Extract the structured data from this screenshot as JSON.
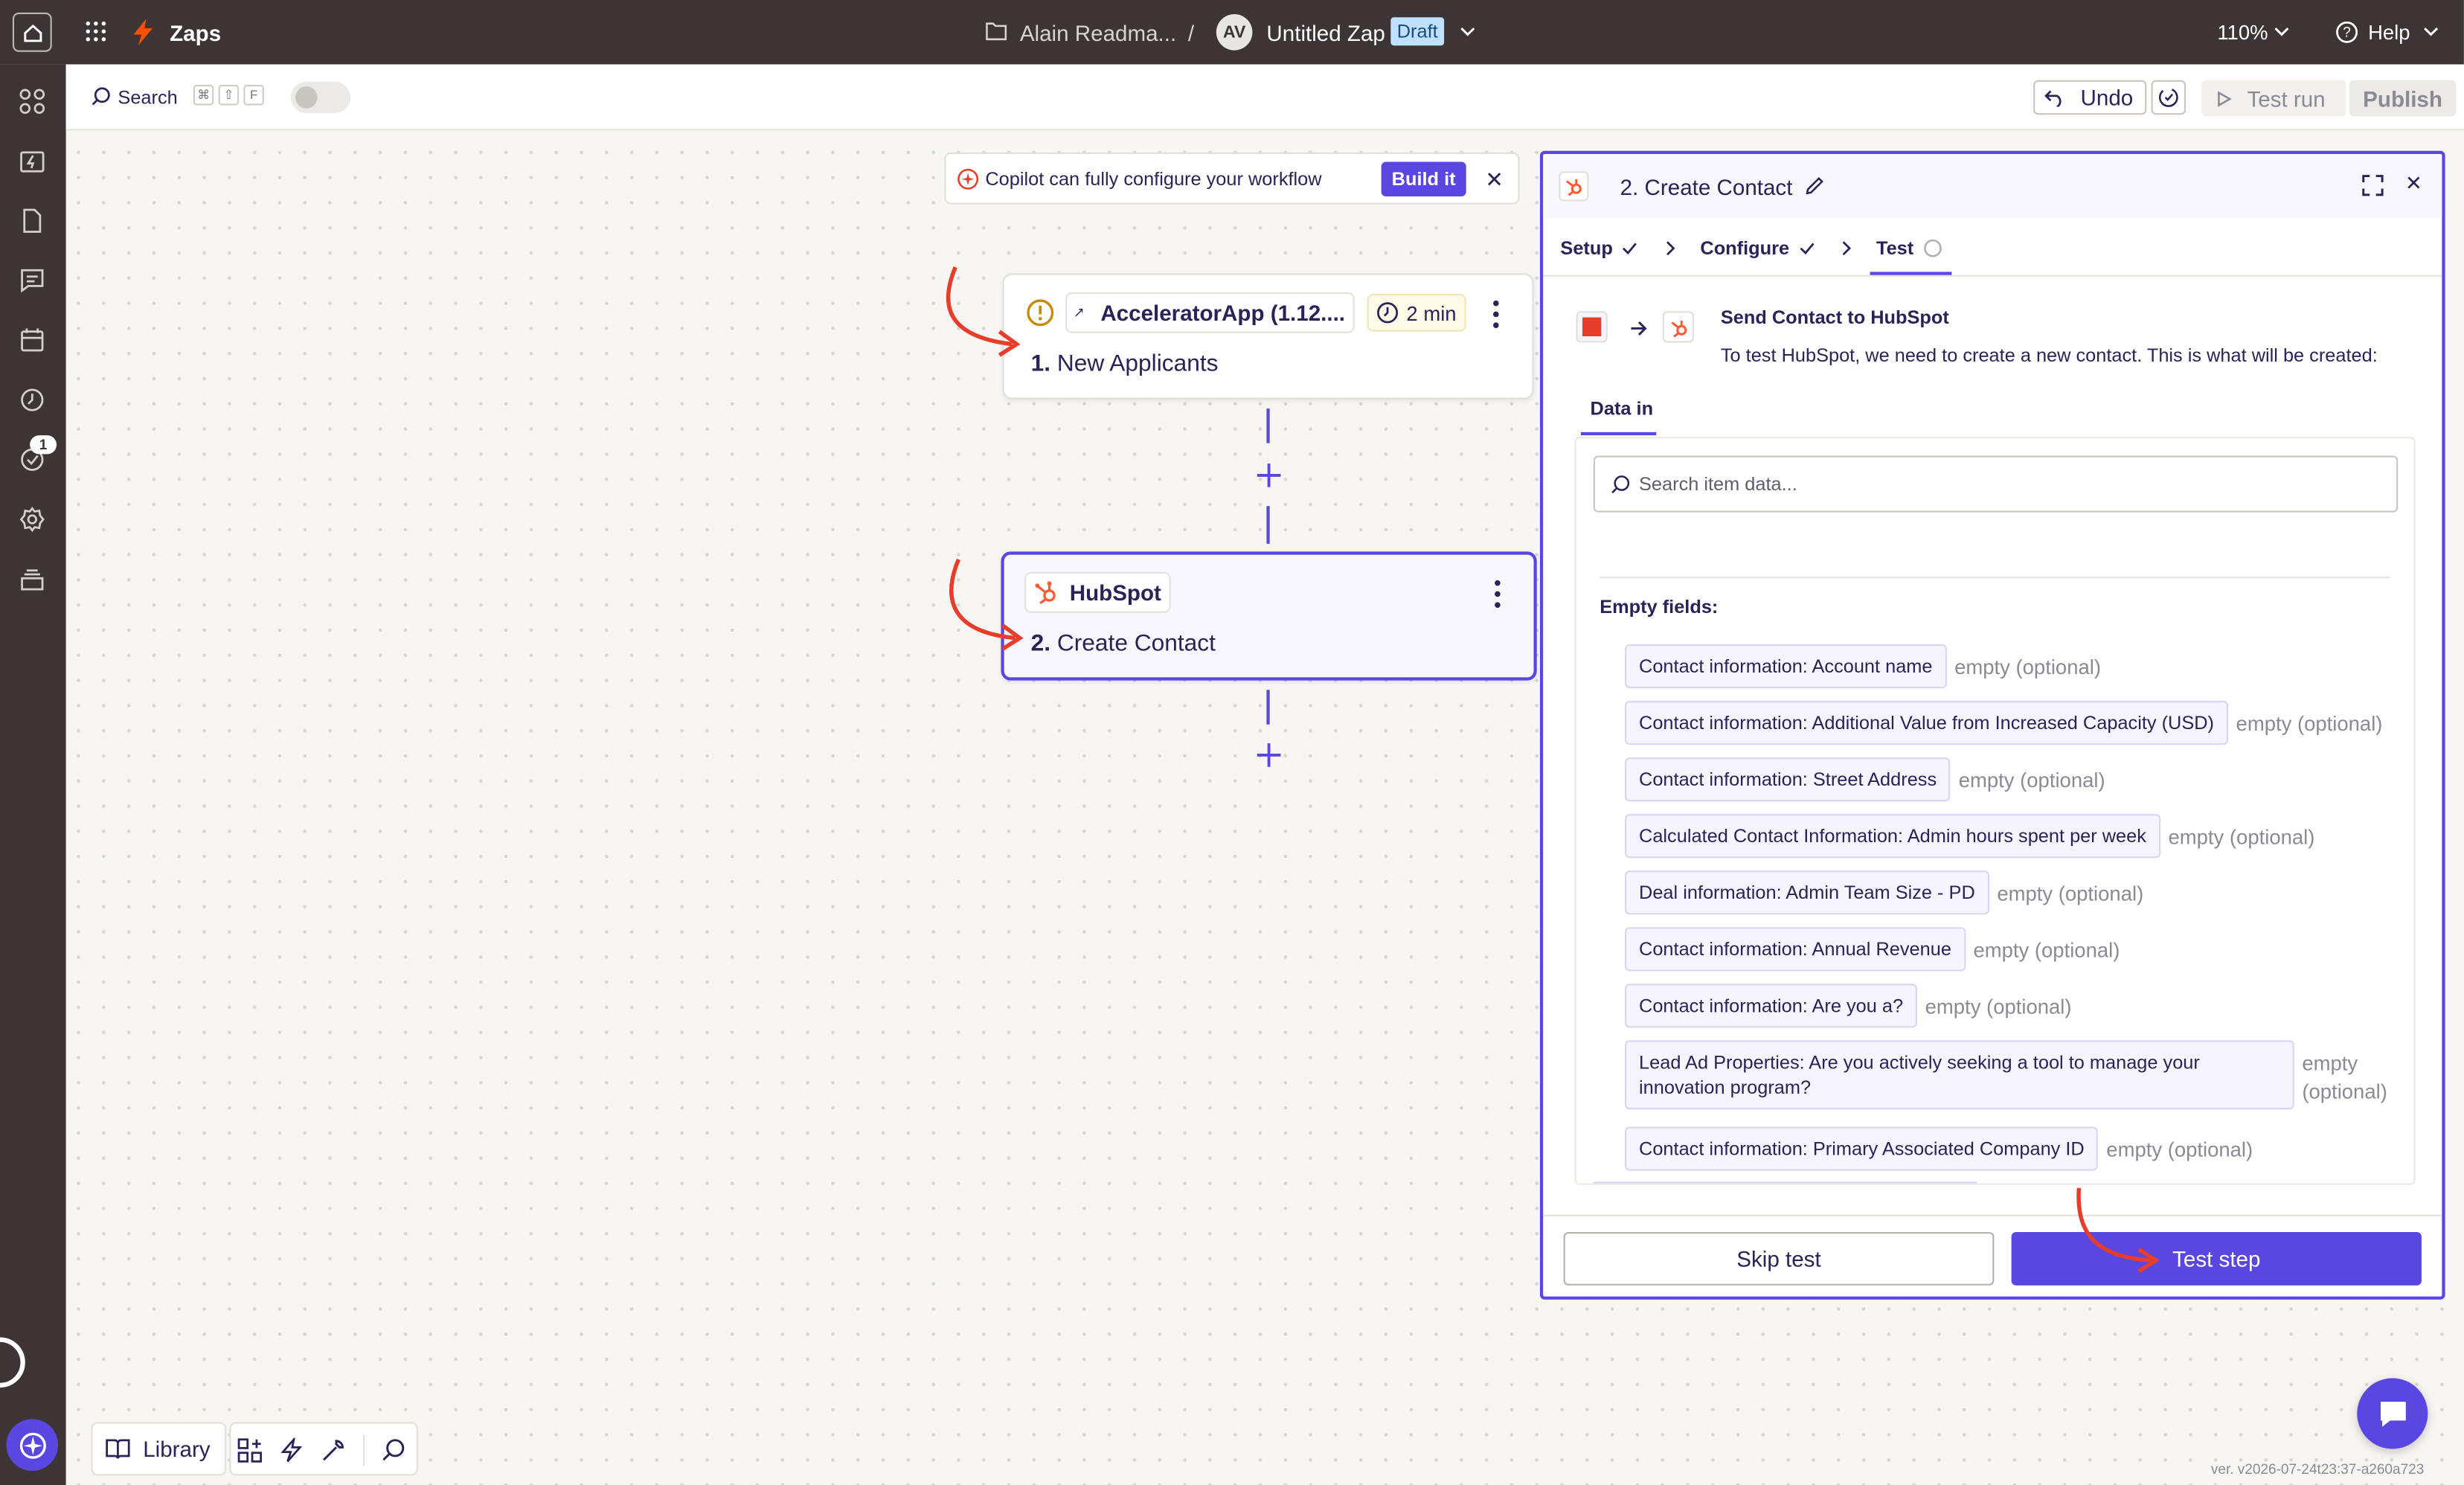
{
  "topbar": {
    "app_name": "Zaps",
    "folder": "Alain Readma...",
    "separator": "/",
    "avatar_initials": "AV",
    "zap_title": "Untitled Zap",
    "status_badge": "Draft",
    "zoom": "110%",
    "help": "Help"
  },
  "sidebar": {
    "items": [
      {
        "icon": "apps-icon"
      },
      {
        "icon": "zap-history-icon"
      },
      {
        "icon": "document-icon"
      },
      {
        "icon": "chat-icon"
      },
      {
        "icon": "calendar-icon"
      },
      {
        "icon": "history-icon"
      },
      {
        "icon": "runs-icon",
        "badge": "1"
      },
      {
        "icon": "settings-icon"
      },
      {
        "icon": "layers-icon"
      }
    ]
  },
  "toolbar": {
    "search_label": "Search",
    "shortcut_keys": [
      "⌘",
      "⇧",
      "F"
    ],
    "undo_label": "Undo",
    "test_run_label": "Test run",
    "publish_label": "Publish"
  },
  "copilot": {
    "message": "Copilot can fully configure your workflow",
    "button": "Build it"
  },
  "steps": [
    {
      "app": "AcceleratorApp (1.12....",
      "duration": "2 min",
      "number": "1.",
      "title": "New Applicants"
    },
    {
      "app": "HubSpot",
      "number": "2.",
      "title": "Create Contact"
    }
  ],
  "panel": {
    "title": "2. Create Contact",
    "tabs": [
      {
        "label": "Setup"
      },
      {
        "label": "Configure"
      },
      {
        "label": "Test"
      }
    ],
    "send_title": "Send Contact to HubSpot",
    "send_desc": "To test HubSpot, we need to create a new contact. This is what will be created:",
    "data_tab": "Data in",
    "search_placeholder": "Search item data...",
    "empty_heading": "Empty fields:",
    "fields": [
      {
        "label": "Contact information: Account name",
        "value": "empty (optional)"
      },
      {
        "label": "Contact information: Additional Value from Increased Capacity (USD)",
        "value": "empty (optional)"
      },
      {
        "label": "Contact information: Street Address",
        "value": "empty (optional)"
      },
      {
        "label": "Calculated Contact Information: Admin hours spent per week",
        "value": "empty (optional)"
      },
      {
        "label": "Deal information: Admin Team Size - PD",
        "value": "empty (optional)"
      },
      {
        "label": "Contact information: Annual Revenue",
        "value": "empty (optional)"
      },
      {
        "label": "Contact information: Are you a?",
        "value": "empty (optional)"
      },
      {
        "label": "Lead Ad Properties: Are you actively seeking a tool to manage your innovation program?",
        "value": "empty (optional)"
      },
      {
        "label": "Contact information: Primary Associated Company ID",
        "value": "empty (optional)"
      }
    ],
    "skip_button": "Skip test",
    "test_button": "Test step"
  },
  "bottom_toolbar": {
    "library": "Library"
  },
  "version": "ver. v2026-07-24t23:37-a260a723",
  "colors": {
    "accent": "#5a46e0",
    "topbar": "#3d3535",
    "zap_orange": "#ff4f00",
    "annotation_red": "#e63e2b",
    "draft_badge": "#bfe0ff"
  }
}
